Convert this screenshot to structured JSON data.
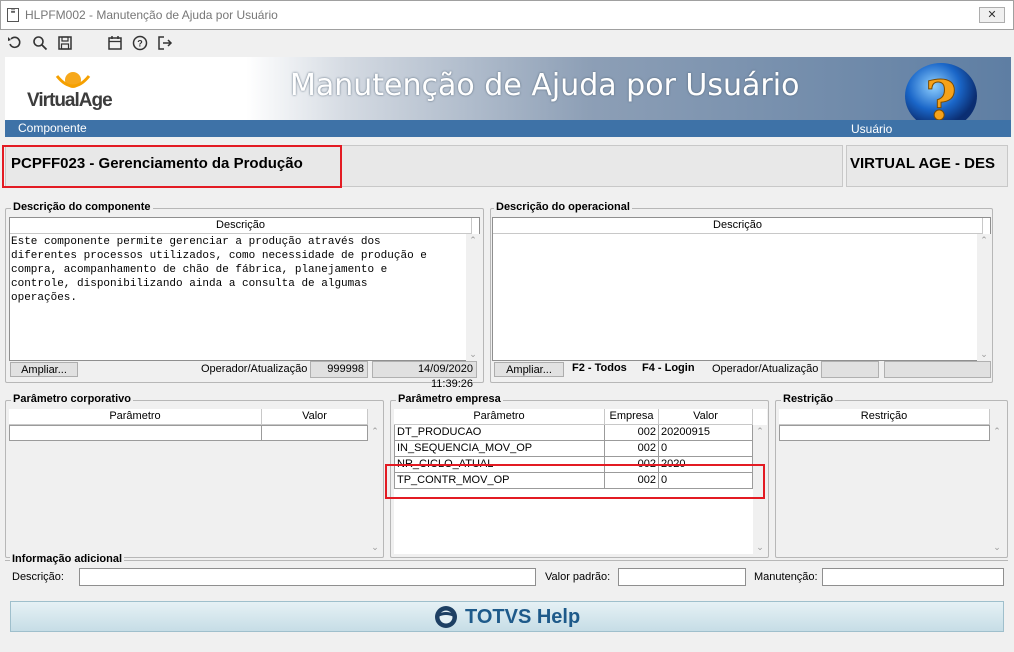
{
  "window": {
    "title": "HLPFM002 - Manutenção de Ajuda por Usuário",
    "close_label": "✕"
  },
  "banner": {
    "logo_text": "VirtualAge",
    "title": "Manutenção de Ajuda por Usuário",
    "left_label": "Componente",
    "right_label": "Usuário"
  },
  "component": {
    "name": "PCPFF023 - Gerenciamento da Produção",
    "user": "VIRTUAL AGE - DES"
  },
  "desc_componente": {
    "legend": "Descrição do componente",
    "col": "Descrição",
    "text": "Este componente permite gerenciar a produção através dos\ndiferentes processos utilizados, como necessidade de produção e\ncompra, acompanhamento de chão de fábrica, planejamento e\ncontrole, disponibilizando ainda a consulta de algumas\noperações.",
    "ampliar": "Ampliar...",
    "op_label": "Operador/Atualização",
    "operator": "999998",
    "updated": "14/09/2020 11:39:26"
  },
  "desc_operacional": {
    "legend": "Descrição do operacional",
    "col": "Descrição",
    "ampliar": "Ampliar...",
    "f2": "F2 - Todos",
    "f4": "F4 - Login",
    "op_label": "Operador/Atualização",
    "operator": "",
    "updated": ""
  },
  "param_corp": {
    "legend": "Parâmetro corporativo",
    "col_param": "Parâmetro",
    "col_valor": "Valor"
  },
  "param_emp": {
    "legend": "Parâmetro empresa",
    "col_param": "Parâmetro",
    "col_emp": "Empresa",
    "col_valor": "Valor",
    "rows": [
      {
        "p": "DT_PRODUCAO",
        "e": "002",
        "v": "20200915"
      },
      {
        "p": "IN_SEQUENCIA_MOV_OP",
        "e": "002",
        "v": "0"
      },
      {
        "p": "NR_CICLO_ATUAL",
        "e": "002",
        "v": "2020"
      },
      {
        "p": "TP_CONTR_MOV_OP",
        "e": "002",
        "v": "0"
      }
    ]
  },
  "restricao": {
    "legend": "Restrição",
    "col": "Restrição"
  },
  "info": {
    "legend": "Informação adicional",
    "descricao": "Descrição:",
    "valor_padrao": "Valor padrão:",
    "manutencao": "Manutenção:"
  },
  "footer": {
    "brand": "TOTVS Help"
  },
  "colors": {
    "highlight": "#e31b23",
    "band": "#3e72a7",
    "totvs": "#1e5a8a"
  }
}
